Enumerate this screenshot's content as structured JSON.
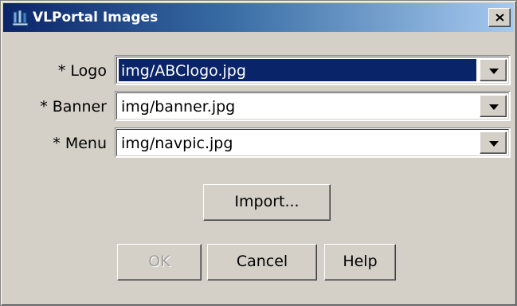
{
  "window": {
    "title": "VLPortal Images",
    "close_label": "×"
  },
  "fields": [
    {
      "label": "* Logo",
      "value": "img/ABClogo.jpg",
      "selected": true
    },
    {
      "label": "* Banner",
      "value": "img/banner.jpg",
      "selected": false
    },
    {
      "label": "* Menu",
      "value": "img/navpic.jpg",
      "selected": false
    }
  ],
  "buttons": {
    "import": "Import...",
    "ok": "OK",
    "cancel": "Cancel",
    "help": "Help"
  },
  "colors": {
    "titlebar_start": "#0a246a",
    "titlebar_end": "#a6caf0",
    "selection": "#0a246a",
    "dialog_bg": "#d4d0c8"
  }
}
